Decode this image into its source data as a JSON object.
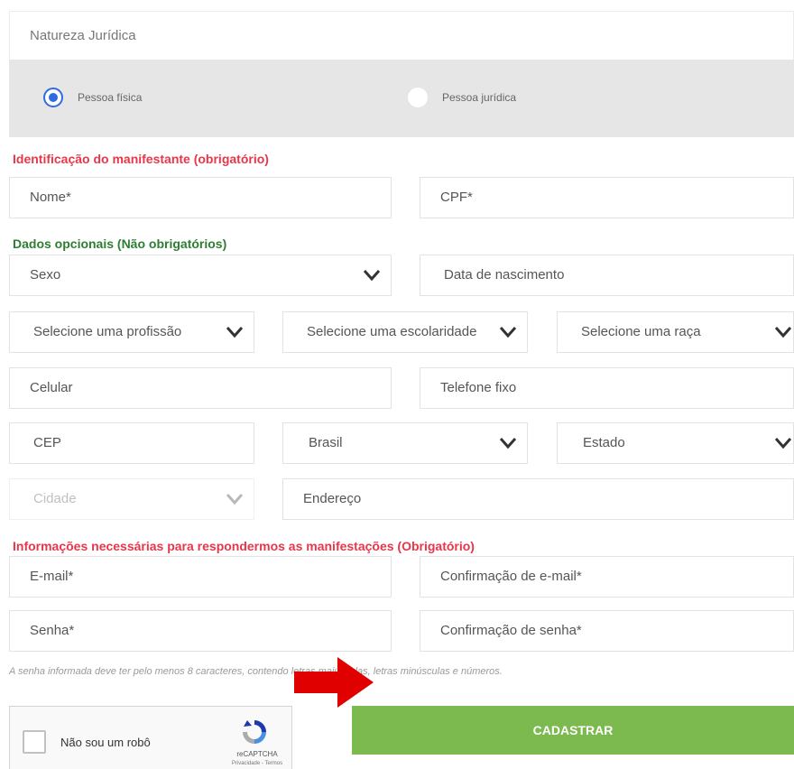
{
  "natureza": {
    "label": "Natureza Jurídica",
    "options": [
      {
        "label": "Pessoa física",
        "selected": true
      },
      {
        "label": "Pessoa jurídica",
        "selected": false
      }
    ]
  },
  "identificacao": {
    "heading": "Identificação do manifestante (obrigatório)",
    "nome_placeholder": "Nome*",
    "cpf_placeholder": "CPF*"
  },
  "opcionais": {
    "heading": "Dados opcionais (Não obrigatórios)",
    "sexo": "Sexo",
    "data_nascimento": "Data de nascimento",
    "profissao": "Selecione uma profissão",
    "escolaridade": "Selecione uma escolaridade",
    "raca": "Selecione uma raça",
    "celular": "Celular",
    "telefone_fixo": "Telefone fixo",
    "cep": "CEP",
    "pais": "Brasil",
    "estado": "Estado",
    "cidade": "Cidade",
    "endereco": "Endereço"
  },
  "acesso": {
    "heading": "Informações necessárias para respondermos as manifestações (Obrigatório)",
    "email": "E-mail*",
    "confirm_email": "Confirmação de e-mail*",
    "senha": "Senha*",
    "confirm_senha": "Confirmação de senha*",
    "hint": "A senha informada deve ter pelo menos 8 caracteres, contendo letras maiúsculas, letras minúsculas e números."
  },
  "captcha": {
    "label": "Não sou um robô",
    "brand": "reCAPTCHA",
    "terms": "Privacidade - Termos"
  },
  "submit": {
    "label": "CADASTRAR"
  },
  "colors": {
    "required_heading": "#e8364a",
    "optional_heading": "#2e7d32",
    "submit": "#7cb94f",
    "radio_selected": "#2f6ce0",
    "arrow": "#e10000"
  }
}
